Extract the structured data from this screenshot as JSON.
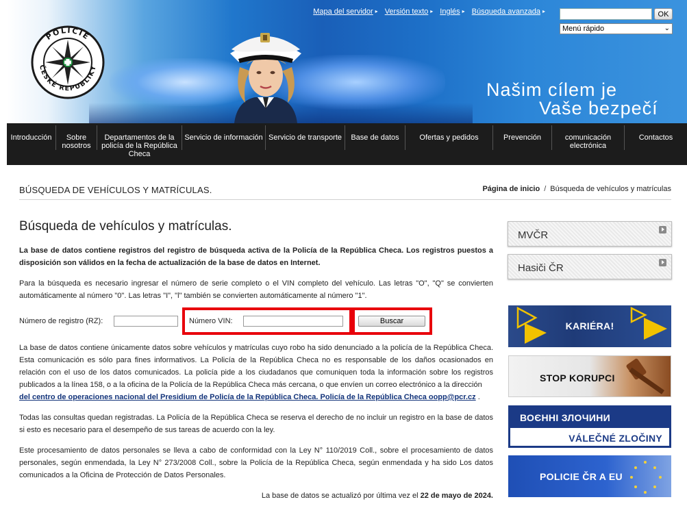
{
  "header": {
    "top_links": [
      {
        "label": "Mapa del servidor"
      },
      {
        "label": "Versión texto"
      },
      {
        "label": "Inglés"
      },
      {
        "label": "Búsqueda avanzada"
      }
    ],
    "search_ok_label": "OK",
    "quick_menu_value": "Menú rápido",
    "slogan_line1": "Našim cílem je",
    "slogan_line2": "Vaše bezpečí",
    "logo_text": "POLICIE ČESKÉ REPUBLIKY"
  },
  "nav": {
    "items": [
      {
        "label": "Introducción"
      },
      {
        "label": "Sobre nosotros"
      },
      {
        "label": "Departamentos de la policía de la República Checa"
      },
      {
        "label": "Servicio de información"
      },
      {
        "label": "Servicio de transporte"
      },
      {
        "label": "Base de datos"
      },
      {
        "label": "Ofertas y pedidos"
      },
      {
        "label": "Prevención"
      },
      {
        "label": "comunicación electrónica"
      },
      {
        "label": "Contactos"
      }
    ]
  },
  "page": {
    "section_title": "BÚSQUEDA DE VEHÍCULOS Y MATRÍCULAS.",
    "breadcrumb_home": "Página de inicio",
    "breadcrumb_sep": "/",
    "breadcrumb_current": "Búsqueda de vehículos y matrículas"
  },
  "main": {
    "title": "Búsqueda de vehículos y matrículas.",
    "intro": "La base de datos contiene registros del registro de búsqueda activa de la Policía de la República Checa. Los registros puestos a disposición son válidos en la fecha de actualización de la base de datos en Internet.",
    "instructions": "Para la búsqueda es necesario ingresar el número de serie completo o el VIN completo del vehículo. Las letras \"O\", \"Q\" se convierten automáticamente al número \"0\". Las letras \"I\", \"l\" también se convierten automáticamente al número \"1\".",
    "reg_label": "Número de registro (RZ):",
    "reg_value": "",
    "vin_label": "Número VIN:",
    "vin_value": "",
    "search_button": "Buscar",
    "description": "La base de datos contiene únicamente datos sobre vehículos y matrículas cuyo robo ha sido denunciado a la policía de la República Checa. Esta comunicación es sólo para fines informativos. La Policía de la República Checa no es responsable de los daños ocasionados en relación con el uso de los datos comunicados. La policía pide a los ciudadanos que comuniquen toda la información sobre los registros publicados a la línea 158, o a la oficina de la Policía de la República Checa más cercana, o que envíen un correo electrónico a la dirección",
    "description_link": "del centro de operaciones nacional del Presidium de Policía de la República Checa. Policía de la República Checa oopp@pcr.cz",
    "description_end": ".",
    "logged": "Todas las consultas quedan registradas. La Policía de la República Checa se reserva el derecho de no incluir un registro en la base de datos si esto es necesario para el desempeño de sus tareas de acuerdo con la ley.",
    "gdpr": "Este procesamiento de datos personales se lleva a cabo de conformidad con la Ley N° 110/2019 Coll., sobre el procesamiento de datos personales, según enmendada, la Ley N° 273/2008 Coll., sobre la Policía de la República Checa, según enmendada y ha sido Los datos comunicados a la Oficina de Protección de Datos Personales.",
    "updated_prefix": "La base de datos se actualizó por última vez el",
    "updated_date": "22 de mayo de 2024."
  },
  "sidebar": {
    "mvcr": "MVČR",
    "hasici": "Hasiči ČR",
    "kariera": "KARIÉRA!",
    "korupci": "STOP KORUPCI",
    "valecne_top": "ВОЄННІ ЗЛОЧИНИ",
    "valecne_bottom": "VÁLEČNÉ ZLOČINY",
    "eu": "POLICIE ČR A EU"
  },
  "colors": {
    "highlight_red": "#e8000b",
    "nav_bg": "#1c1c1c",
    "header_blue": "#1d6fc7",
    "link_blue": "#12337a"
  }
}
